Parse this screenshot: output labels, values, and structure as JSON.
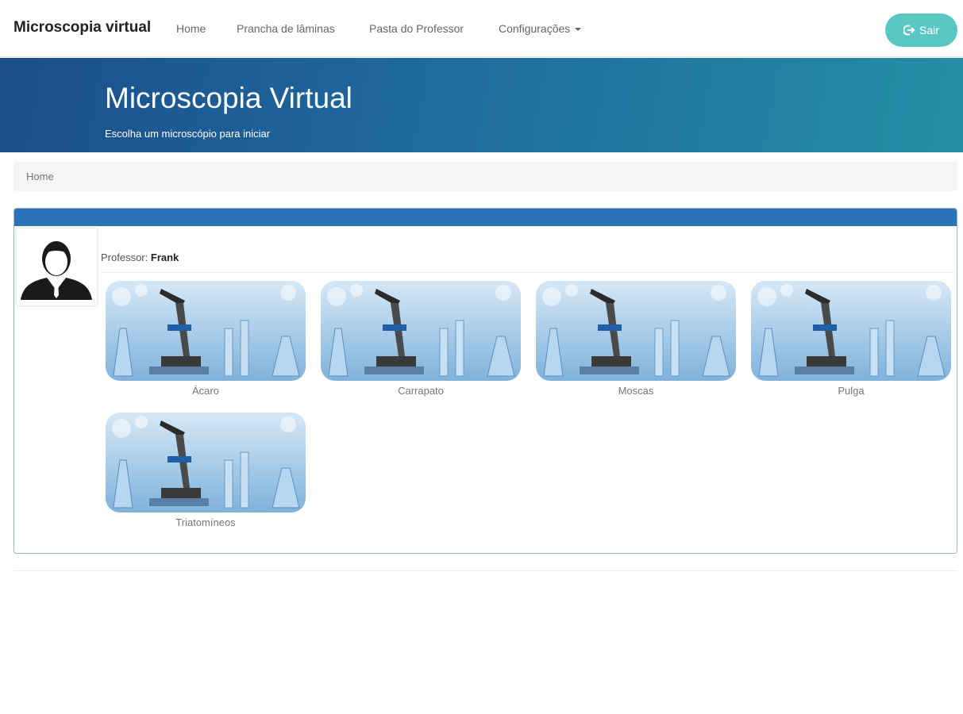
{
  "navbar": {
    "brand": "Microscopia virtual",
    "links": [
      "Home",
      "Prancha de lâminas",
      "Pasta do Professor",
      "Configurações"
    ],
    "logout_label": "Sair"
  },
  "banner": {
    "title": "Microscopia Virtual",
    "subtitle": "Escolha um microscópio para iniciar"
  },
  "breadcrumb": {
    "current": "Home"
  },
  "panel": {
    "professor_label": "Professor:",
    "professor_name": "Frank",
    "microscopes": [
      {
        "label": "Ácaro"
      },
      {
        "label": "Carrapato"
      },
      {
        "label": "Moscas"
      },
      {
        "label": "Pulga"
      },
      {
        "label": "Triatomíneos"
      }
    ]
  },
  "colors": {
    "accent": "#2a73b7",
    "logout": "#5bc7c3",
    "banner_start": "#1b4e8b",
    "banner_end": "#238fa4"
  }
}
